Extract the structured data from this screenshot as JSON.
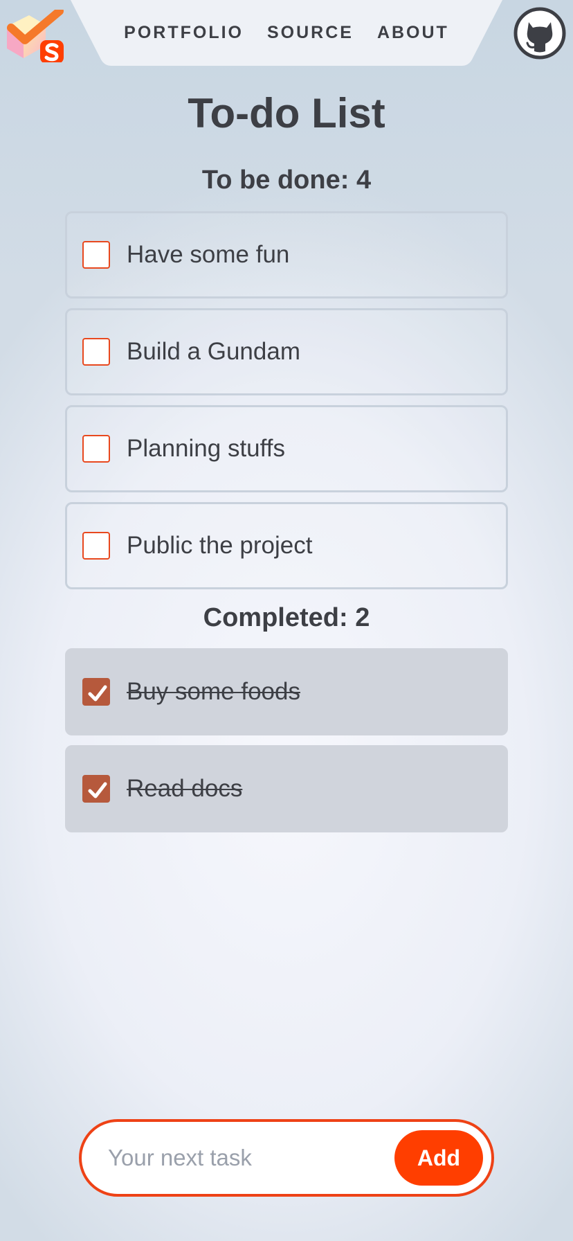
{
  "nav": {
    "links": [
      "PORTFOLIO",
      "SOURCE",
      "ABOUT"
    ]
  },
  "header": {
    "logo_icon": "todo-svelte-logo-icon",
    "github_icon": "github-octocat-icon"
  },
  "page": {
    "title": "To-do List"
  },
  "pending": {
    "heading": "To be done: 4",
    "items": [
      "Have some fun",
      "Build a Gundam",
      "Planning stuffs",
      "Public the project"
    ]
  },
  "completed": {
    "heading": "Completed: 2",
    "items": [
      "Buy some foods",
      "Read docs"
    ]
  },
  "composer": {
    "placeholder": "Your next task",
    "value": "",
    "add_label": "Add"
  },
  "colors": {
    "accent": "#ff3e00",
    "checked_fill": "#b6593c",
    "text": "#3d3f45",
    "done_bg": "#d0d4dc"
  }
}
